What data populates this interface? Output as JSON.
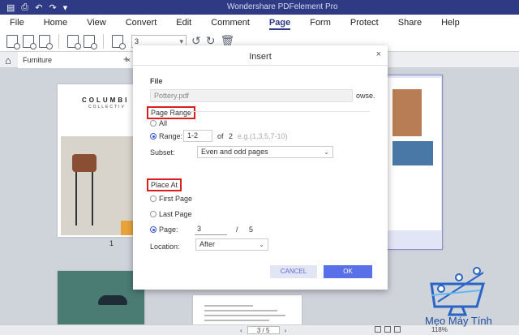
{
  "titlebar": {
    "app_title": "Wondershare PDFelement Pro",
    "quick_access": [
      "▤",
      "⎙",
      "↶",
      "↷",
      "▾"
    ]
  },
  "menu": [
    "File",
    "Home",
    "View",
    "Convert",
    "Edit",
    "Comment",
    "Page",
    "Form",
    "Protect",
    "Share",
    "Help"
  ],
  "menu_active": "Page",
  "toolbar": {
    "page_number": "3"
  },
  "tabs": {
    "document": "Furniture",
    "new_tab": "+"
  },
  "thumbnails": {
    "brand_line1": "COLUMBI",
    "brand_line2": "COLLECTIV",
    "page1_label": "1"
  },
  "statusbar": {
    "page_indicator": "3 / 5",
    "zoom": "118%"
  },
  "watermark": {
    "name": "Mẹo Máy Tính"
  },
  "dialog": {
    "title": "Insert",
    "file_label": "File",
    "file_value": "Pottery.pdf",
    "browse_label": "owse.",
    "page_range_label": "Page Range",
    "all_label": "All",
    "range_label": "Range:",
    "range_value": "1-2",
    "of_label": "of",
    "total_pages_source": "2",
    "range_hint": "e.g.(1,3,5,7-10)",
    "subset_label": "Subset:",
    "subset_value": "Even and odd pages",
    "place_at_label": "Place At",
    "first_page_label": "First Page",
    "last_page_label": "Last Page",
    "page_label": "Page:",
    "page_value": "3",
    "page_separator": "/",
    "page_total": "5",
    "location_label": "Location:",
    "location_value": "After",
    "cancel_label": "CANCEL",
    "ok_label": "OK"
  },
  "colors": {
    "titlebar": "#2e3b84",
    "accent": "#5a70e8",
    "highlight_box": "#d82020"
  }
}
